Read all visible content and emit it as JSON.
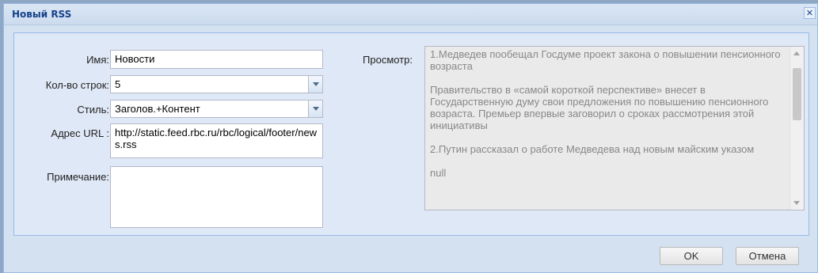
{
  "dialog": {
    "title": "Новый RSS",
    "close_glyph": "✕",
    "close_icon": "close-icon"
  },
  "form": {
    "name": {
      "label": "Имя:",
      "value": "Новости"
    },
    "rows": {
      "label": "Кол-во строк:",
      "value": "5"
    },
    "style": {
      "label": "Стиль:",
      "value": "Заголов.+Контент"
    },
    "url": {
      "label": "Адрес URL :",
      "value": "http://static.feed.rbc.ru/rbc/logical/footer/news.rss"
    },
    "note": {
      "label": "Примечание:",
      "value": ""
    }
  },
  "preview": {
    "label": "Просмотр:",
    "text": "1.Медведев пообещал Госдуме проект закона о повышении пенсионного возраста\n\nПравительство в «самой короткой перспективе» внесет в Государственную думу свои предложения по повышению пенсионного возраста. Премьер впервые заговорил о сроках рассмотрения этой инициативы\n\n2.Путин рассказал о работе Медведева над новым майским указом\n\nnull"
  },
  "buttons": {
    "ok": "OK",
    "cancel": "Отмена"
  }
}
